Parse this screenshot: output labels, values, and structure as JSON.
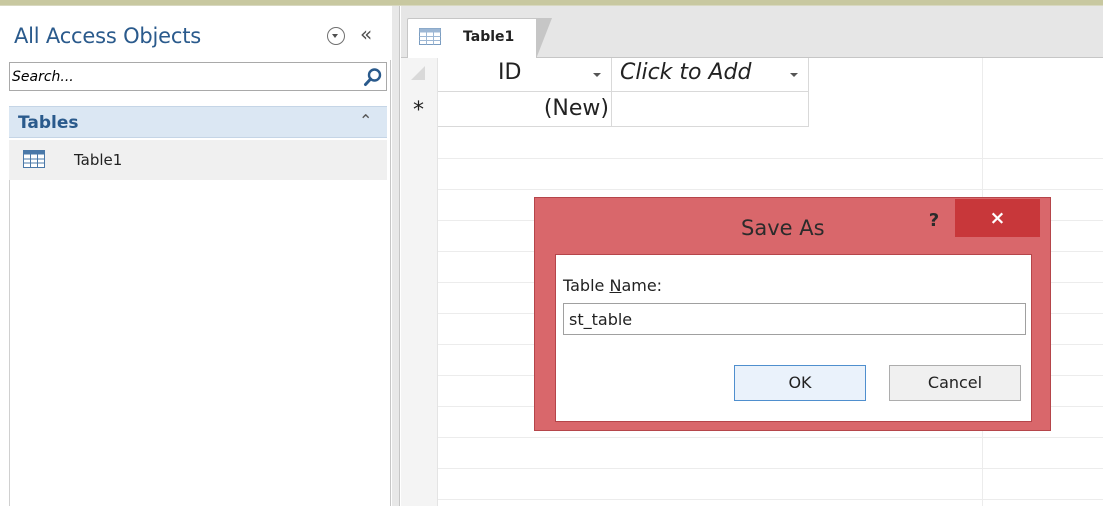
{
  "nav_pane": {
    "title": "All Access Objects",
    "search_placeholder": "Search...",
    "group": {
      "label": "Tables"
    },
    "items": [
      {
        "label": "Table1"
      }
    ]
  },
  "document": {
    "tab_label": "Table1",
    "columns": [
      {
        "label": "ID"
      },
      {
        "label": "Click to Add"
      }
    ],
    "new_row_marker": "*",
    "new_row_value": "(New)"
  },
  "dialog": {
    "title": "Save As",
    "help_label": "?",
    "close_label": "×",
    "field_label_prefix": "Table ",
    "field_label_accel": "N",
    "field_label_suffix": "ame:",
    "field_value": "st_table",
    "ok_label": "OK",
    "cancel_label": "Cancel"
  },
  "icons": {
    "nav_dropdown": "chevron-circle-down-icon",
    "nav_collapse": "double-chevron-left-icon",
    "search": "search-icon",
    "group_collapse": "double-chevron-up-icon",
    "table": "table-icon"
  },
  "colors": {
    "accent_blue": "#2a5a8c",
    "dialog_frame": "#d9676b",
    "close_button": "#c8373a",
    "group_header": "#dbe7f3"
  }
}
